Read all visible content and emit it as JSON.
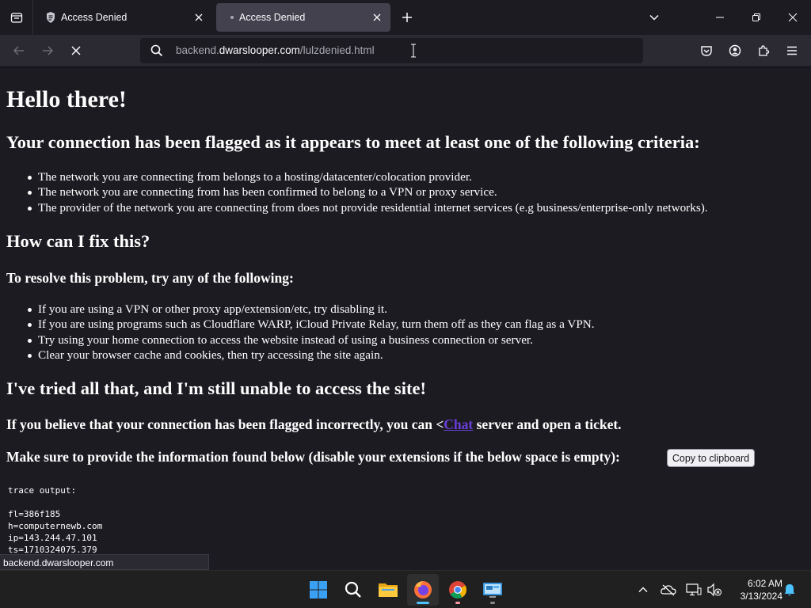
{
  "tabs": [
    {
      "title": "Access Denied",
      "active": false,
      "icon": "shield-stack-icon"
    },
    {
      "title": "Access Denied",
      "active": true,
      "icon": "loading-dot-icon"
    }
  ],
  "urlbar": {
    "url_domain_prefix": "backend.",
    "url_domain": "dwarslooper.com",
    "url_path": "/lulzdenied.html"
  },
  "page": {
    "title": "Hello there!",
    "flagged_heading": "Your connection has been flagged as it appears to meet at least one of the following criteria:",
    "criteria": [
      "The network you are connecting from belongs to a hosting/datacenter/colocation provider.",
      "The network you are connecting from has been confirmed to belong to a VPN or proxy service.",
      "The provider of the network you are connecting from does not provide residential internet services (e.g business/enterprise-only networks)."
    ],
    "fix_heading": "How can I fix this?",
    "resolve_heading": "To resolve this problem, try any of the following:",
    "fixes": [
      "If you are using a VPN or other proxy app/extension/etc, try disabling it.",
      "If you are using programs such as Cloudflare WARP, iCloud Private Relay, turn them off as they can flag as a VPN.",
      "Try using your home connection to access the website instead of using a business connection or server.",
      "Clear your browser cache and cookies, then try accessing the site again."
    ],
    "still_heading": "I've tried all that, and I'm still unable to access the site!",
    "ticket_before": "If you believe that your connection has been flagged incorrectly, you can <",
    "ticket_link": "Chat",
    "ticket_after": " server and open a ticket.",
    "provide_info": "Make sure to provide the information found below (disable your extensions if the below space is empty):",
    "copy_button": "Copy to clipboard",
    "trace_label": "trace output:",
    "trace_lines": [
      "fl=386f185",
      "h=computernewb.com",
      "ip=143.244.47.101",
      "ts=1710324075.379"
    ]
  },
  "status_text": "backend.dwarslooper.com",
  "clock": {
    "time": "6:02 AM",
    "date": "3/13/2024"
  },
  "colors": {
    "link": "#6b3fd9",
    "page_bg": "#1c1b22",
    "toolbar_bg": "#2b2a33",
    "active_tab": "#42414d",
    "taskbar_bg": "#202020"
  }
}
